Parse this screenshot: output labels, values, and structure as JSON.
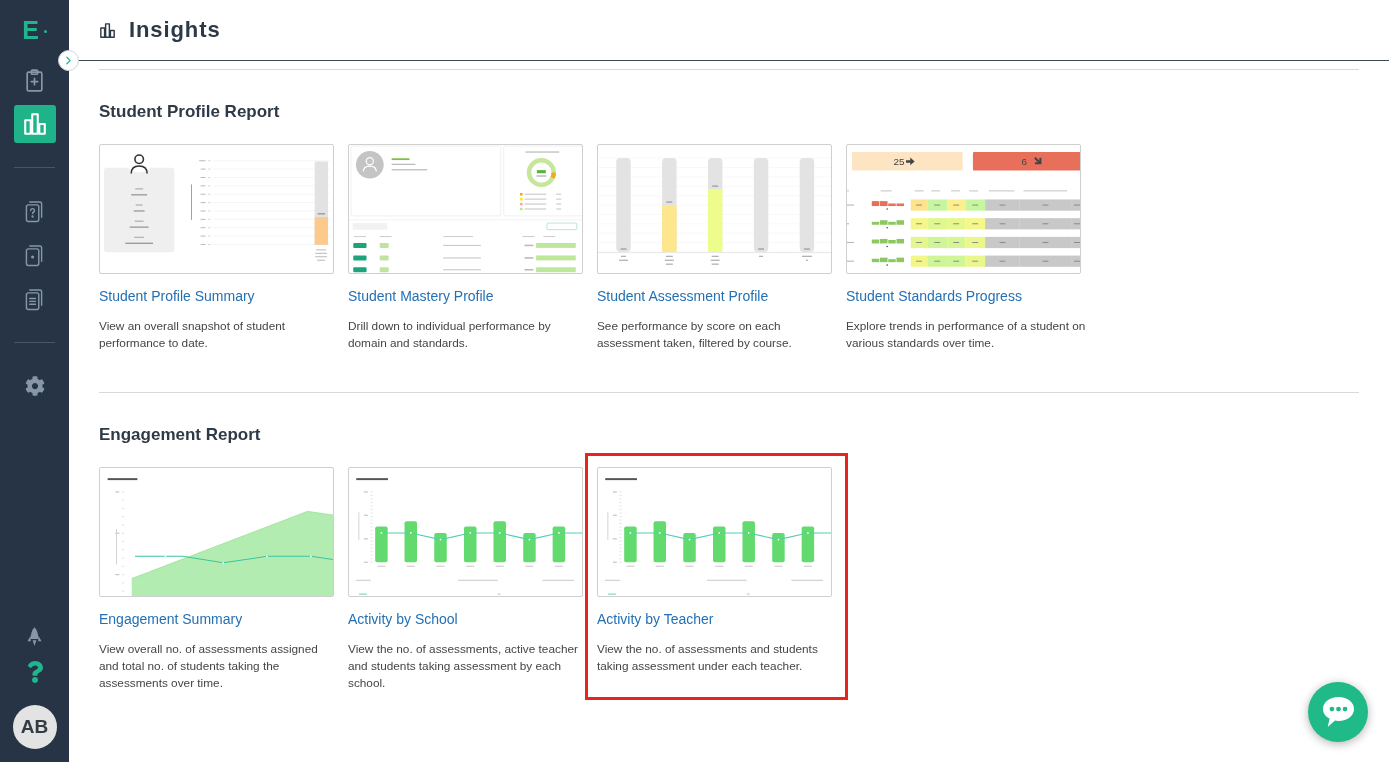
{
  "sidebar": {
    "logo": "E",
    "nav_groups": [
      {
        "items": [
          {
            "selected": false
          },
          {
            "selected": true
          }
        ]
      },
      {
        "items": [
          {
            "selected": false
          },
          {
            "selected": false
          },
          {
            "selected": false
          }
        ]
      },
      {
        "items": [
          {
            "selected": false
          }
        ]
      }
    ],
    "avatar": "AB"
  },
  "header": {
    "title": "Insights"
  },
  "sections": [
    {
      "title": "Student Profile Report",
      "cards": [
        {
          "title": "Student Profile Summary",
          "description": "View an overall snapshot of student performance to date.",
          "highlighted": false,
          "preview": {
            "kind": "profile_summary"
          }
        },
        {
          "title": "Student Mastery Profile",
          "description": "Drill down to individual performance by domain and standards.",
          "highlighted": false,
          "preview": {
            "kind": "mastery_profile"
          }
        },
        {
          "title": "Student Assessment Profile",
          "description": "See performance by score on each assessment taken, filtered by course.",
          "highlighted": false,
          "preview": {
            "kind": "assessment_profile"
          }
        },
        {
          "title": "Student Standards Progress",
          "description": "Explore trends in performance of a student on various standards over time.",
          "highlighted": false,
          "preview": {
            "kind": "standards_progress",
            "tiles": [
              {
                "value": "25",
                "color": "#fde5c3"
              },
              {
                "value": "6",
                "color": "#e8705a"
              }
            ]
          }
        }
      ]
    },
    {
      "title": "Engagement Report",
      "cards": [
        {
          "title": "Engagement Summary",
          "description": "View overall no. of assessments assigned and total no. of students taking the assessments over time.",
          "highlighted": false,
          "preview": {
            "kind": "activity_timeline"
          }
        },
        {
          "title": "Activity by School",
          "description": "View the no. of assessments, active teacher and students taking assessment by each school.",
          "highlighted": false,
          "preview": {
            "kind": "activity_bars"
          }
        },
        {
          "title": "Activity by Teacher",
          "description": "View the no. of assessments and students taking assessment under each teacher.",
          "highlighted": true,
          "preview": {
            "kind": "activity_bars"
          }
        }
      ]
    }
  ]
}
